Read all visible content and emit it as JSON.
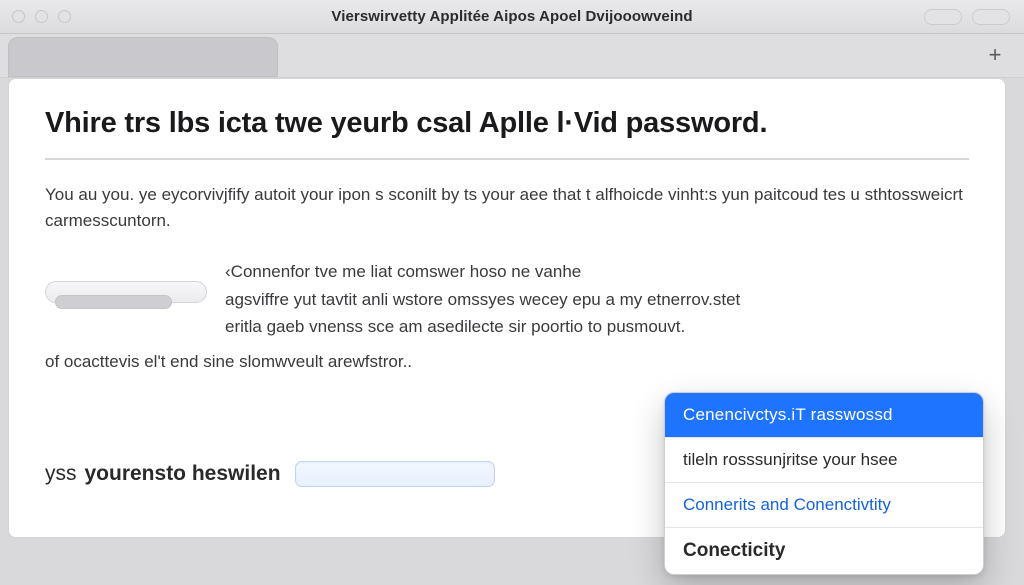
{
  "window": {
    "title": "Vierswirvetty Applitée Aipos Apoel Dvijooowveind"
  },
  "page": {
    "heading": "Vhire trs lbs icta twe yeurb csal Aplle l·Vid password.",
    "body1": "You au you. ye eycorvivjfify autoit your ipon s sconilt by ts your aee that t alfhoicde vinht:s yun paitcoud tes u sthtossweicrt carmesscuntorn.",
    "mid_line1": "‹Connenfor tve me liat comswer hoso ne vanhe",
    "mid_line2": "agsviffre yut tavtit anli wstore omssyes wecey epu a my etnerrov.stet",
    "mid_line3": "eritla gaeb vnenss sce am asedilecte sir poortio to pusmouvt.",
    "trail": "of ocacttevis el't end sine slomwveult arewfstror..",
    "footer_ys": "yss",
    "footer_bold": "yourensto heswilen"
  },
  "popover": {
    "selected": "Cenencivctys.iT rasswossd",
    "opt2": "tileln rosssunjritse your hsee",
    "opt3": "Connerits and Conenctivtity",
    "opt4": "Conecticity"
  }
}
